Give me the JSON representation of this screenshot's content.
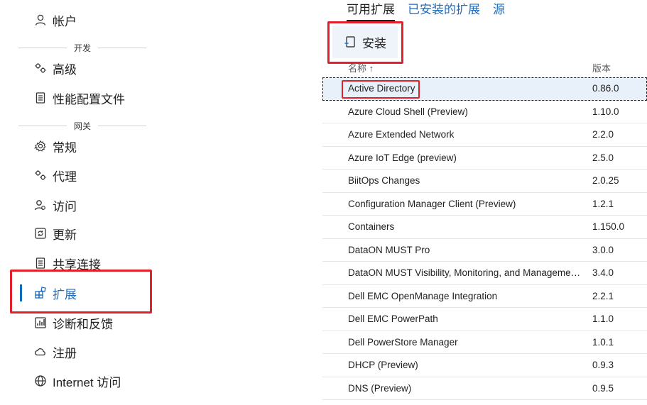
{
  "sidebar": {
    "account": "帐户",
    "section_dev": "开发",
    "advanced": "高级",
    "perf_profile": "性能配置文件",
    "section_gateway": "网关",
    "general": "常规",
    "proxy": "代理",
    "access": "访问",
    "update": "更新",
    "shared_connections": "共享连接",
    "extensions": "扩展",
    "diagnostics": "诊断和反馈",
    "register": "注册",
    "internet_access": "Internet 访问"
  },
  "tabs": [
    "可用扩展",
    "已安装的扩展",
    "源"
  ],
  "toolbar": {
    "install_label": "安装"
  },
  "table": {
    "headers": {
      "name": "名称 ↑",
      "version": "版本"
    },
    "rows": [
      {
        "name": "Active Directory",
        "version": "0.86.0"
      },
      {
        "name": "Azure Cloud Shell (Preview)",
        "version": "1.10.0"
      },
      {
        "name": "Azure Extended Network",
        "version": "2.2.0"
      },
      {
        "name": "Azure IoT Edge (preview)",
        "version": "2.5.0"
      },
      {
        "name": "BiitOps Changes",
        "version": "2.0.25"
      },
      {
        "name": "Configuration Manager Client (Preview)",
        "version": "1.2.1"
      },
      {
        "name": "Containers",
        "version": "1.150.0"
      },
      {
        "name": "DataON MUST Pro",
        "version": "3.0.0"
      },
      {
        "name": "DataON MUST Visibility, Monitoring, and Management...",
        "version": "3.4.0"
      },
      {
        "name": "Dell EMC OpenManage Integration",
        "version": "2.2.1"
      },
      {
        "name": "Dell EMC PowerPath",
        "version": "1.1.0"
      },
      {
        "name": "Dell PowerStore Manager",
        "version": "1.0.1"
      },
      {
        "name": "DHCP (Preview)",
        "version": "0.9.3"
      },
      {
        "name": "DNS (Preview)",
        "version": "0.9.5"
      }
    ]
  },
  "colors": {
    "accent": "#1a6dc2",
    "highlight_box": "#e0202b",
    "selected_row_bg": "#e8f0f9"
  },
  "icons": [
    "person-icon",
    "gears-icon",
    "document-icon",
    "gear-icon",
    "gears-icon",
    "people-icon",
    "refresh-icon",
    "document-icon",
    "extension-icon",
    "diagnostics-icon",
    "cloud-icon",
    "globe-icon",
    "install-icon"
  ]
}
